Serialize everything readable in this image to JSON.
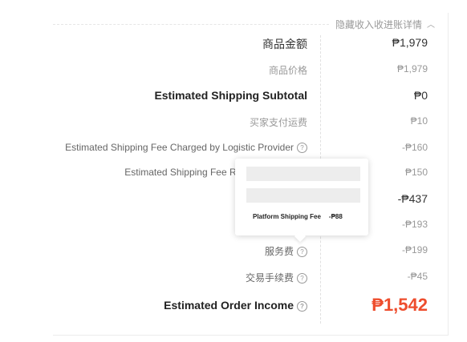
{
  "header": {
    "toggle_label": "隐藏收入收进账详情"
  },
  "rows": [
    {
      "label": "商品金额",
      "value": "₱1,979"
    },
    {
      "label": "商品价格",
      "value": "₱1,979"
    },
    {
      "label": "Estimated Shipping Subtotal",
      "value": "₱0"
    },
    {
      "label": "买家支付运费",
      "value": "₱10"
    },
    {
      "label": "Estimated Shipping Fee Charged by Logistic Provider",
      "value": "-₱160"
    },
    {
      "label": "Estimated Shipping Fee Reb",
      "value": "₱150"
    },
    {
      "label": "",
      "value": "-₱437"
    },
    {
      "label": "",
      "value": "-₱193"
    },
    {
      "label": "服务费",
      "value": "-₱199"
    },
    {
      "label": "交易手续费",
      "value": "-₱45"
    }
  ],
  "income": {
    "label": "Estimated Order Income",
    "value": "₱1,542"
  },
  "tooltip": {
    "line_label": "Platform Shipping Fee",
    "line_value": "-₱88"
  },
  "colors": {
    "accent": "#ee4d2d"
  }
}
